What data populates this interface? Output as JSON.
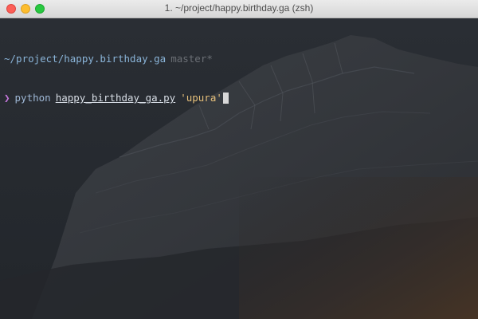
{
  "window": {
    "title": "1. ~/project/happy.birthday.ga (zsh)"
  },
  "terminal": {
    "cwd": "~/project/happy.birthday.ga",
    "branch": "master*",
    "prompt_symbol": "❯",
    "command": "python",
    "script": "happy_birthday_ga.py",
    "argument": "'upura'"
  },
  "colors": {
    "path": "#8ab4d8",
    "branch": "#6b6f75",
    "prompt": "#c678dd",
    "argument": "#e6c07b",
    "background": "#23272d"
  },
  "icons": {
    "close": "close-button",
    "minimize": "minimize-button",
    "zoom": "zoom-button"
  }
}
